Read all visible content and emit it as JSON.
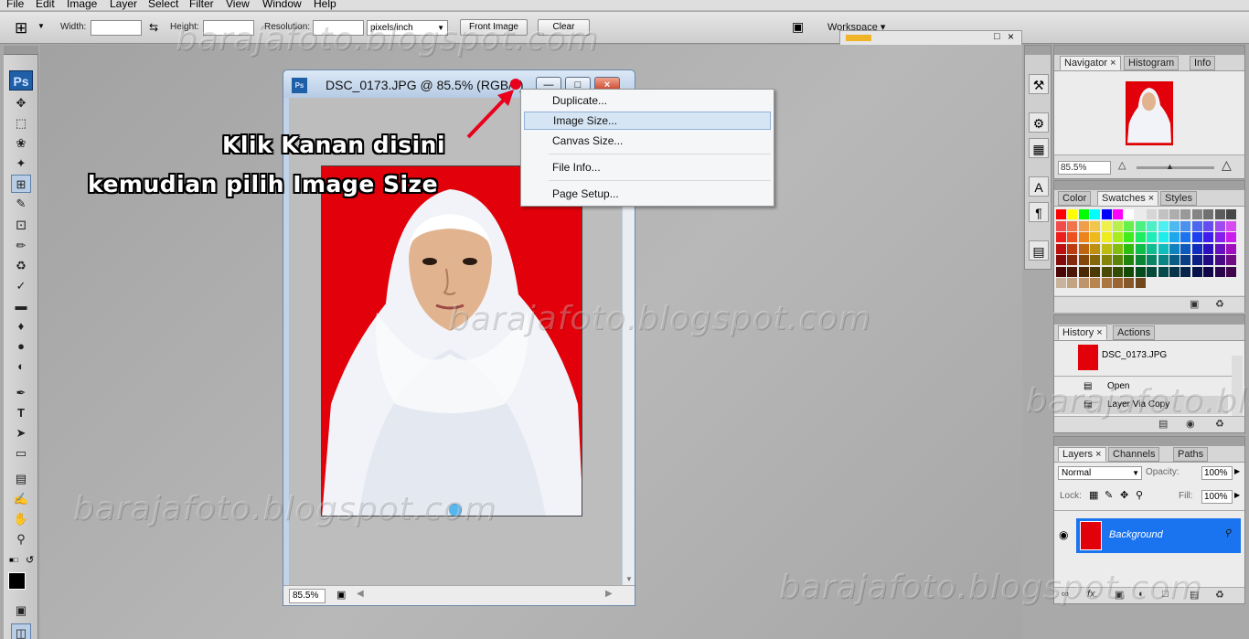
{
  "menu": [
    "File",
    "Edit",
    "Image",
    "Layer",
    "Select",
    "Filter",
    "View",
    "Window",
    "Help"
  ],
  "options": {
    "width_label": "Width:",
    "height_label": "Height:",
    "resolution_label": "Resolution:",
    "units": "pixels/inch",
    "front_image": "Front Image",
    "clear": "Clear",
    "workspace": "Workspace ▾"
  },
  "document": {
    "title": "DSC_0173.JPG @ 85.5% (RGB/8)",
    "zoom": "85.5%"
  },
  "context_menu": {
    "items": [
      "Duplicate...",
      "Image Size...",
      "Canvas Size...",
      "File Info...",
      "Page Setup..."
    ],
    "highlighted": "Image Size..."
  },
  "annotation": {
    "line1": "Klik Kanan disini",
    "line2": "kemudian pilih Image Size",
    "arrow_color": "#e8001c"
  },
  "watermark": "barajafoto.blogspot.com",
  "navigator": {
    "tabs": [
      "Navigator",
      "Histogram",
      "Info"
    ],
    "zoom": "85.5%"
  },
  "swatches": {
    "tabs": [
      "Color",
      "Swatches",
      "Styles"
    ]
  },
  "history": {
    "tabs": [
      "History",
      "Actions"
    ],
    "snapshot": "DSC_0173.JPG",
    "states": [
      "Open",
      "Layer Via Copy"
    ]
  },
  "layers": {
    "tabs": [
      "Layers",
      "Channels",
      "Paths"
    ],
    "blend_mode": "Normal",
    "opacity_label": "Opacity:",
    "opacity": "100%",
    "lock_label": "Lock:",
    "fill_label": "Fill:",
    "fill": "100%",
    "layer_name": "Background"
  },
  "colors": {
    "accent": "#1a74f0",
    "photo_bg": "#e2000a"
  }
}
